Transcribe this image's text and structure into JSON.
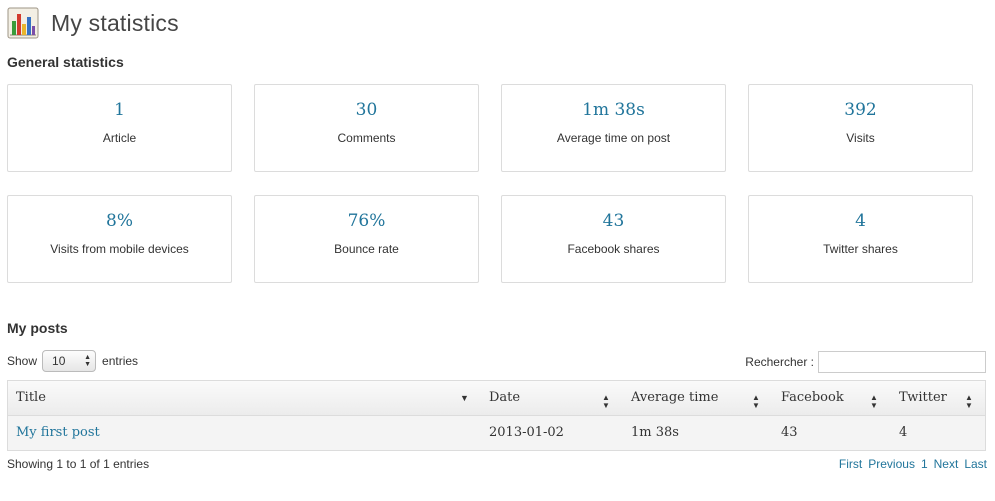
{
  "page": {
    "title": "My statistics",
    "icon": "bar-chart-icon"
  },
  "general": {
    "heading": "General statistics",
    "stats": [
      {
        "value": "1",
        "label": "Article"
      },
      {
        "value": "30",
        "label": "Comments"
      },
      {
        "value": "1m 38s",
        "label": "Average time on post"
      },
      {
        "value": "392",
        "label": "Visits"
      },
      {
        "value": "8%",
        "label": "Visits from mobile devices"
      },
      {
        "value": "76%",
        "label": "Bounce rate"
      },
      {
        "value": "43",
        "label": "Facebook shares"
      },
      {
        "value": "4",
        "label": "Twitter shares"
      }
    ]
  },
  "posts": {
    "heading": "My posts",
    "show_label": "Show",
    "entries_value": "10",
    "entries_label": "entries",
    "search_label": "Rechercher :",
    "search_value": "",
    "columns": [
      "Title",
      "Date",
      "Average time",
      "Facebook",
      "Twitter"
    ],
    "rows": [
      {
        "title": "My first post",
        "date": "2013-01-02",
        "avg_time": "1m 38s",
        "facebook": "43",
        "twitter": "4"
      }
    ],
    "info": "Showing 1 to 1 of 1 entries",
    "pagination": {
      "first": "First",
      "previous": "Previous",
      "page": "1",
      "next": "Next",
      "last": "Last"
    }
  },
  "colors": {
    "accent": "#21759b",
    "border": "#dcdcdc",
    "row_bg": "#f4f4f4"
  }
}
